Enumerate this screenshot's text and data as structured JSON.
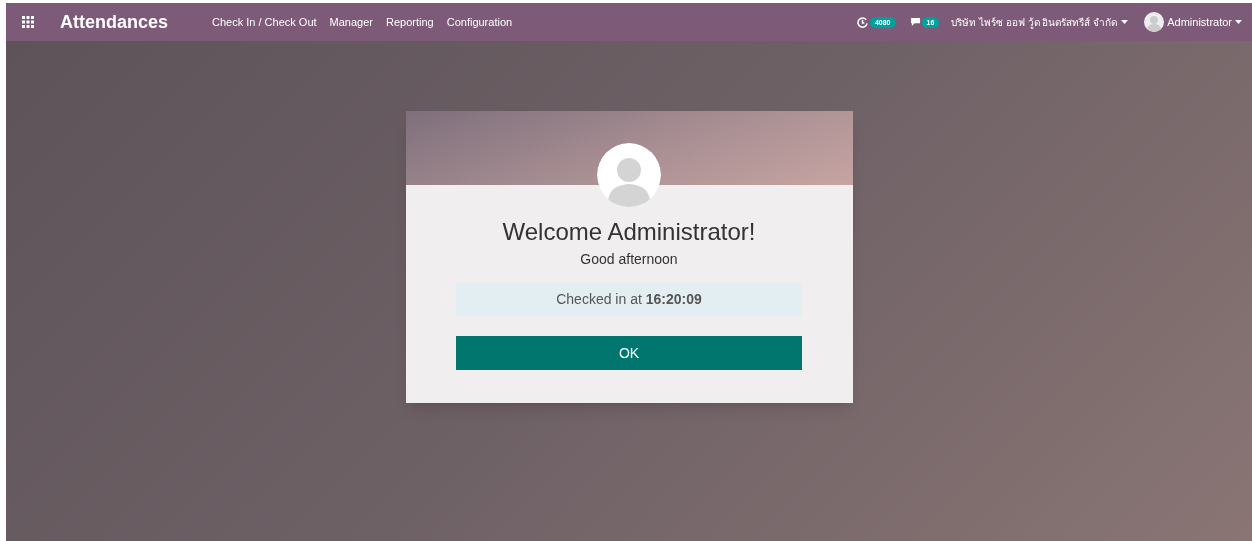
{
  "navbar": {
    "app_title": "Attendances",
    "menu": [
      {
        "label": "Check In / Check Out"
      },
      {
        "label": "Manager"
      },
      {
        "label": "Reporting"
      },
      {
        "label": "Configuration"
      }
    ],
    "activity_count": "4080",
    "message_count": "16",
    "company": "บริษัท ไพร์ซ ออฟ วู้ด อินดรัสทรีส์ จำกัด",
    "user": "Administrator"
  },
  "dialog": {
    "title": "Welcome Administrator!",
    "greeting": "Good afternoon",
    "status": "Checked in at **16:20:09**",
    "button": "OK"
  }
}
